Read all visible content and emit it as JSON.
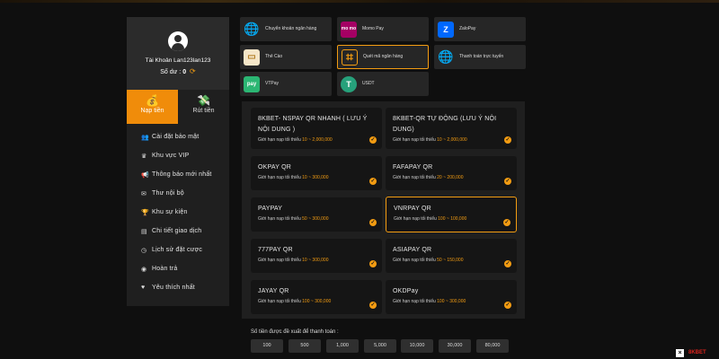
{
  "profile": {
    "account_label": "Tài Khoản Lan123lan123",
    "balance_label": "Số dư :",
    "balance_value": "0"
  },
  "tabs": [
    {
      "label": "Nạp tiền",
      "icon": "deposit-icon"
    },
    {
      "label": "Rút tiền",
      "icon": "withdraw-icon"
    }
  ],
  "menu": [
    {
      "label": "Cài đặt bảo mật",
      "icon": "user-security-icon"
    },
    {
      "label": "Khu vực VIP",
      "icon": "crown-icon"
    },
    {
      "label": "Thông báo mới nhất",
      "icon": "megaphone-icon"
    },
    {
      "label": "Thư nội bộ",
      "icon": "mail-icon"
    },
    {
      "label": "Khu sự kiện",
      "icon": "trophy-icon"
    },
    {
      "label": "Chi tiết giao dịch",
      "icon": "receipt-icon"
    },
    {
      "label": "Lịch sử đặt cược",
      "icon": "history-icon"
    },
    {
      "label": "Hoàn trả",
      "icon": "refund-icon"
    },
    {
      "label": "Yêu thích nhất",
      "icon": "heart-icon"
    }
  ],
  "methods": [
    {
      "label": "Chuyển khoản ngân hàng",
      "icon": "globe-icon"
    },
    {
      "label": "Momo Pay",
      "icon": "momo-icon",
      "icon_text": "mo mo"
    },
    {
      "label": "ZaloPay",
      "icon": "zalopay-icon"
    },
    {
      "label": "Thẻ Cào",
      "icon": "scratch-card-icon"
    },
    {
      "label": "Quét mã ngân hàng",
      "icon": "qr-scan-icon"
    },
    {
      "label": "Thanh toán trực tuyến",
      "icon": "globe-icon"
    },
    {
      "label": "VTPay",
      "icon": "vtpay-icon",
      "icon_text": "pay"
    },
    {
      "label": "USDT",
      "icon": "usdt-icon",
      "icon_text": "T"
    }
  ],
  "channels": [
    {
      "name": "8KBET- NSPAY QR NHANH ( LƯU Ý NỘI DUNG )",
      "limit_label": "Giới hạn nạp tối thiểu",
      "range": "10 ~ 2,000,000"
    },
    {
      "name": "8KBET-QR TỰ ĐỘNG (LƯU Ý NỘI DUNG)",
      "limit_label": "Giới hạn nạp tối thiểu",
      "range": "10 ~ 2,000,000"
    },
    {
      "name": "OKPAY QR",
      "limit_label": "Giới hạn nạp tối thiểu",
      "range": "10 ~ 300,000"
    },
    {
      "name": "FAFAPAY QR",
      "limit_label": "Giới hạn nạp tối thiểu",
      "range": "20 ~ 200,000"
    },
    {
      "name": "PAYPAY",
      "limit_label": "Giới hạn nạp tối thiểu",
      "range": "50 ~ 300,000"
    },
    {
      "name": "VNRPAY QR",
      "limit_label": "Giới hạn nạp tối thiểu",
      "range": "100 ~ 100,000"
    },
    {
      "name": "777PAY QR",
      "limit_label": "Giới hạn nạp tối thiểu",
      "range": "10 ~ 300,000"
    },
    {
      "name": "ASIAPAY QR",
      "limit_label": "Giới hạn nạp tối thiểu",
      "range": "50 ~ 150,000"
    },
    {
      "name": "JAYAY QR",
      "limit_label": "Giới hạn nạp tối thiểu",
      "range": "100 ~ 300,000"
    },
    {
      "name": "OKDPay",
      "limit_label": "Giới hạn nạp tối thiểu",
      "range": "100 ~ 300,000"
    }
  ],
  "amounts": {
    "title": "Số tiền được đề xuất để thanh toán :",
    "values": [
      "100",
      "500",
      "1,000",
      "5,000",
      "10,000",
      "30,000",
      "80,000"
    ]
  },
  "corner_text": "8KBET",
  "colors": {
    "accent": "#f39c12",
    "active_tab": "#f08c0a",
    "momo": "#a50064",
    "zalopay": "#0068ff",
    "vtpay": "#2bb673",
    "usdt": "#26a17b"
  }
}
